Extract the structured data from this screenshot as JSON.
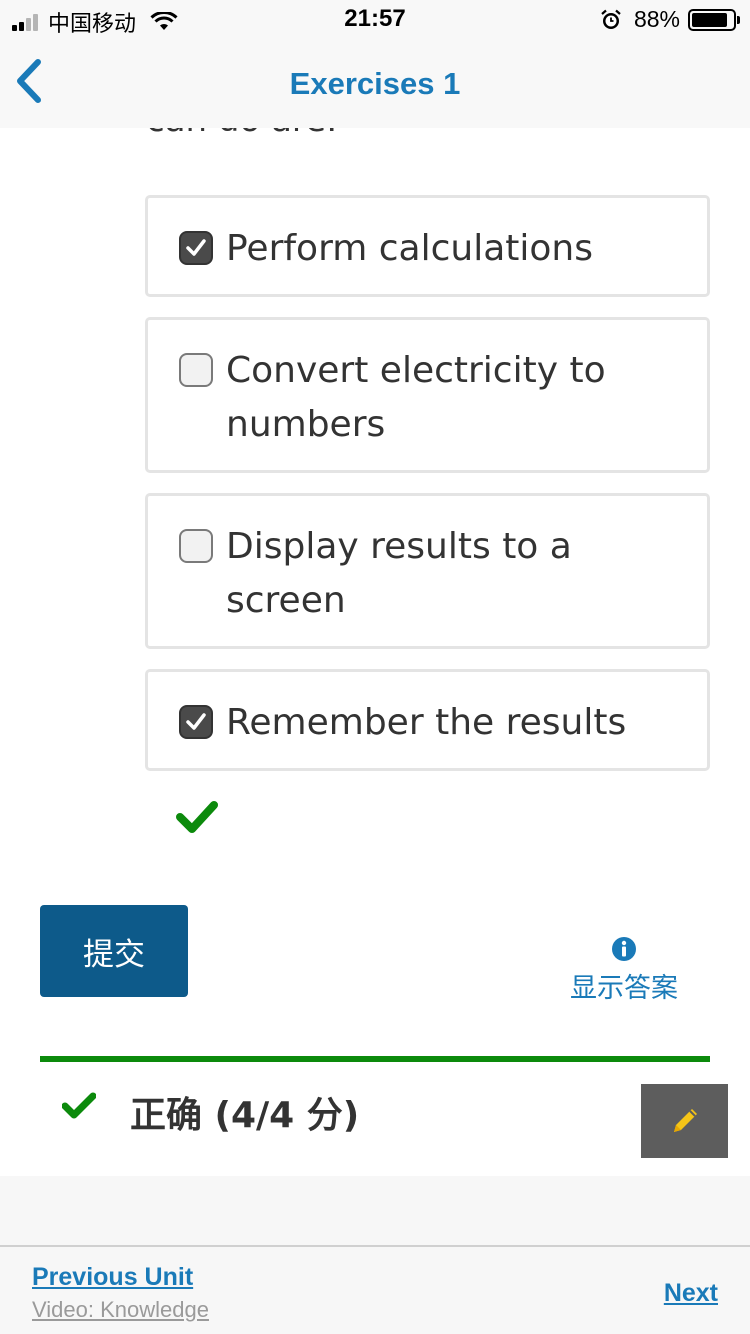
{
  "status_bar": {
    "carrier": "中国移动",
    "time": "21:57",
    "battery": "88%",
    "battery_level": 0.88
  },
  "nav": {
    "title": "Exercises 1",
    "back_icon": "chevron-left-icon"
  },
  "question": {
    "tail_text": "can do are:"
  },
  "options": [
    {
      "label": "Perform calculations",
      "checked": true
    },
    {
      "label": "Convert electricity to numbers",
      "checked": false
    },
    {
      "label": "Display results to a screen",
      "checked": false
    },
    {
      "label": "Remember the results",
      "checked": true
    }
  ],
  "actions": {
    "submit_label": "提交",
    "show_answer_label": "显示答案"
  },
  "result": {
    "text": "正确 (4/4 分)"
  },
  "footer": {
    "previous_label": "Previous Unit",
    "previous_sub": "Video: Knowledge",
    "next_label": "Next"
  },
  "colors": {
    "accent": "#1a7ab8",
    "submit_bg": "#0d5a8a",
    "success": "#0c8a0c",
    "edit_bg": "#5d5d5d",
    "pencil": "#f5c518"
  }
}
